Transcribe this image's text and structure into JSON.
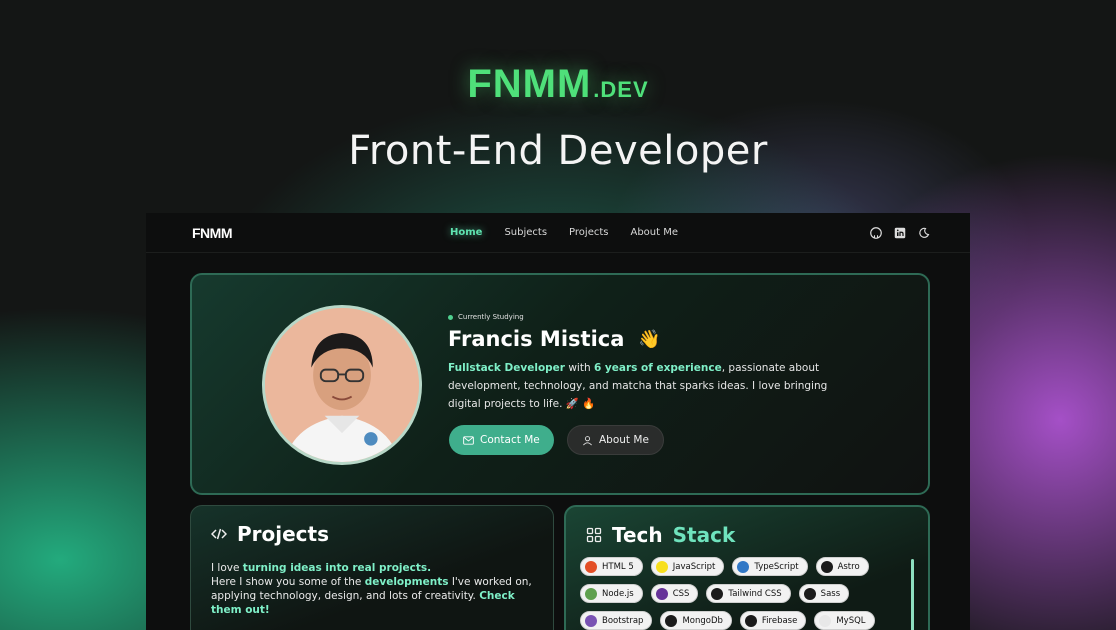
{
  "hero": {
    "logo_main": "FNMM",
    "logo_suffix": ".DEV",
    "subtitle": "Front-End Developer"
  },
  "nav": {
    "logo": "FNMM",
    "links": [
      "Home",
      "Subjects",
      "Projects",
      "About Me"
    ],
    "active": "Home",
    "icons": [
      "github-icon",
      "linkedin-icon",
      "theme-toggle-icon"
    ]
  },
  "profile": {
    "status": "Currently Studying",
    "name": "Francis Mistica",
    "bio_parts": {
      "role": "Fullstack Developer",
      "with": " with ",
      "experience": "6 years of experience",
      "rest": ", passionate about development, technology, and matcha that sparks ideas. I love bringing digital projects to life. 🚀 🔥"
    },
    "contact_label": "Contact Me",
    "about_label": "About Me"
  },
  "projects": {
    "title": "Projects",
    "line1_prefix": "I love ",
    "line1_highlight": "turning ideas into real projects.",
    "line2_prefix": "Here I show you some of the ",
    "line2_highlight": "developments",
    "line2_rest": " I've worked on, applying technology, design, and lots of creativity. ",
    "cta": "Check them out!"
  },
  "tech": {
    "title_a": "Tech",
    "title_b": "Stack",
    "items": [
      {
        "label": "HTML 5",
        "color": "#e34f26"
      },
      {
        "label": "JavaScript",
        "color": "#f7df1e"
      },
      {
        "label": "TypeScript",
        "color": "#3178c6"
      },
      {
        "label": "Astro",
        "color": "#1b1b1b"
      },
      {
        "label": "Node.js",
        "color": "#5fa04e"
      },
      {
        "label": "CSS",
        "color": "#663399"
      },
      {
        "label": "Tailwind CSS",
        "color": "#1b1b1b"
      },
      {
        "label": "Sass",
        "color": "#1b1b1b"
      },
      {
        "label": "Bootstrap",
        "color": "#7952b3"
      },
      {
        "label": "MongoDb",
        "color": "#1b1b1b"
      },
      {
        "label": "Firebase",
        "color": "#1b1b1b"
      },
      {
        "label": "MySQL",
        "color": "#e8e8e8"
      }
    ]
  }
}
